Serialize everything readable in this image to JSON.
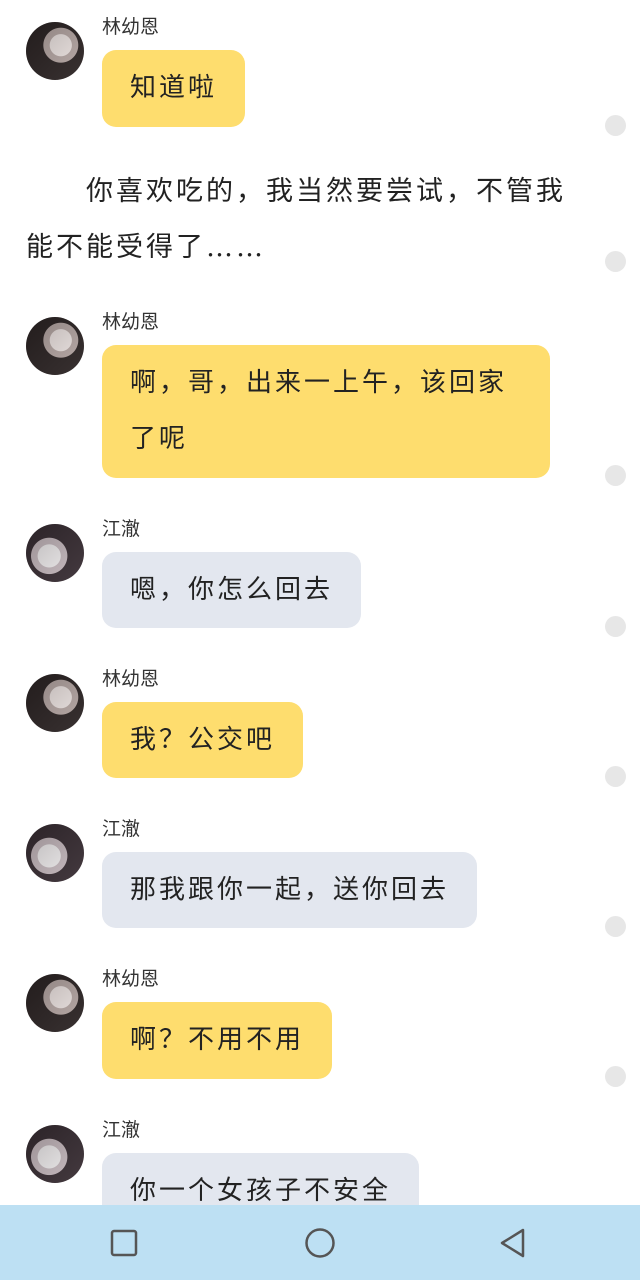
{
  "messages": [
    {
      "speaker": "林幼恩",
      "text": "知道啦"
    },
    {
      "speaker": "林幼恩",
      "text_line1": "啊，哥，出来一上午，该回家",
      "text_line2": "了呢"
    },
    {
      "speaker": "江澈",
      "text": "嗯，你怎么回去"
    },
    {
      "speaker": "林幼恩",
      "text": "我？公交吧"
    },
    {
      "speaker": "江澈",
      "text": "那我跟你一起，送你回去"
    },
    {
      "speaker": "林幼恩",
      "text": "啊？不用不用"
    },
    {
      "speaker": "江澈",
      "text": "你一个女孩子不安全"
    }
  ],
  "narration": {
    "line1": "　　你喜欢吃的，我当然要尝试，不管我",
    "line2": "能不能受得了……"
  },
  "navbar": {
    "icons": [
      "square-icon",
      "circle-icon",
      "triangle-back-icon"
    ]
  },
  "colors": {
    "lin_bubble": "#fedd6e",
    "jiang_bubble": "#e3e7ef",
    "navbar": "#bde0f3"
  }
}
